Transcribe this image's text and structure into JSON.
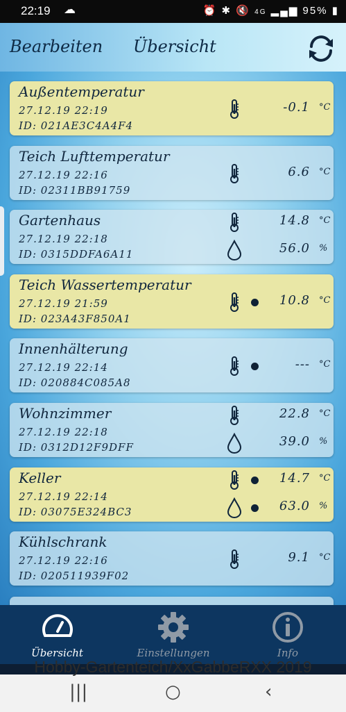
{
  "status_bar": {
    "time": "22:19",
    "battery": "95%",
    "network": "4G",
    "icons": [
      "cloud-icon",
      "alarm-icon",
      "bluetooth-icon",
      "mute-icon",
      "signal-icon",
      "battery-icon"
    ]
  },
  "header": {
    "edit_label": "Bearbeiten",
    "title": "Übersicht",
    "refresh_icon": "refresh-icon"
  },
  "sensors": [
    {
      "name": "Außentemperatur",
      "date": "27.12.19 22:19",
      "id": "ID: 021AE3C4A4F4",
      "highlight": true,
      "readings": [
        {
          "icon": "thermometer-icon",
          "dot": false,
          "value": "-0.1",
          "unit": "°C"
        }
      ]
    },
    {
      "name": "Teich Lufttemperatur",
      "date": "27.12.19 22:16",
      "id": "ID: 02311BB91759",
      "highlight": false,
      "readings": [
        {
          "icon": "thermometer-icon",
          "dot": false,
          "value": "6.6",
          "unit": "°C"
        }
      ]
    },
    {
      "name": "Gartenhaus",
      "date": "27.12.19 22:18",
      "id": "ID: 0315DDFA6A11",
      "highlight": false,
      "readings": [
        {
          "icon": "thermometer-icon",
          "dot": false,
          "value": "14.8",
          "unit": "°C"
        },
        {
          "icon": "humidity-drop-icon",
          "dot": false,
          "value": "56.0",
          "unit": "%"
        }
      ]
    },
    {
      "name": "Teich Wassertemperatur",
      "date": "27.12.19 21:59",
      "id": "ID: 023A43F850A1",
      "highlight": true,
      "readings": [
        {
          "icon": "thermometer-icon",
          "dot": true,
          "value": "10.8",
          "unit": "°C"
        }
      ]
    },
    {
      "name": "Innenhälterung",
      "date": "27.12.19 22:14",
      "id": "ID: 020884C085A8",
      "highlight": false,
      "readings": [
        {
          "icon": "thermometer-icon",
          "dot": true,
          "value": "---",
          "unit": "°C"
        }
      ]
    },
    {
      "name": "Wohnzimmer",
      "date": "27.12.19 22:18",
      "id": "ID: 0312D12F9DFF",
      "highlight": false,
      "readings": [
        {
          "icon": "thermometer-icon",
          "dot": false,
          "value": "22.8",
          "unit": "°C"
        },
        {
          "icon": "humidity-drop-icon",
          "dot": false,
          "value": "39.0",
          "unit": "%"
        }
      ]
    },
    {
      "name": "Keller",
      "date": "27.12.19 22:14",
      "id": "ID: 03075E324BC3",
      "highlight": true,
      "readings": [
        {
          "icon": "thermometer-icon",
          "dot": true,
          "value": "14.7",
          "unit": "°C"
        },
        {
          "icon": "humidity-drop-icon",
          "dot": true,
          "value": "63.0",
          "unit": "%"
        }
      ]
    },
    {
      "name": "Kühlschrank",
      "date": "27.12.19 22:16",
      "id": "ID: 020511939F02",
      "highlight": false,
      "readings": [
        {
          "icon": "thermometer-icon",
          "dot": false,
          "value": "9.1",
          "unit": "°C"
        }
      ]
    }
  ],
  "tabs": [
    {
      "label": "Übersicht",
      "icon": "speedometer-icon",
      "active": true
    },
    {
      "label": "Einstellungen",
      "icon": "gear-icon",
      "active": false
    },
    {
      "label": "Info",
      "icon": "info-icon",
      "active": false
    }
  ],
  "watermark": "Hobby-Gartenteich/XxGabbeRXX 2019",
  "nav_bar": {
    "recent": "|||",
    "home": "○",
    "back": "‹"
  },
  "colors": {
    "card_highlight": "#e9e7a6",
    "card_default": "#cde4f0",
    "tab_bar": "#0d3660",
    "tab_active": "#ffffff",
    "tab_inactive": "#8f9aa6",
    "text": "#10263d"
  }
}
